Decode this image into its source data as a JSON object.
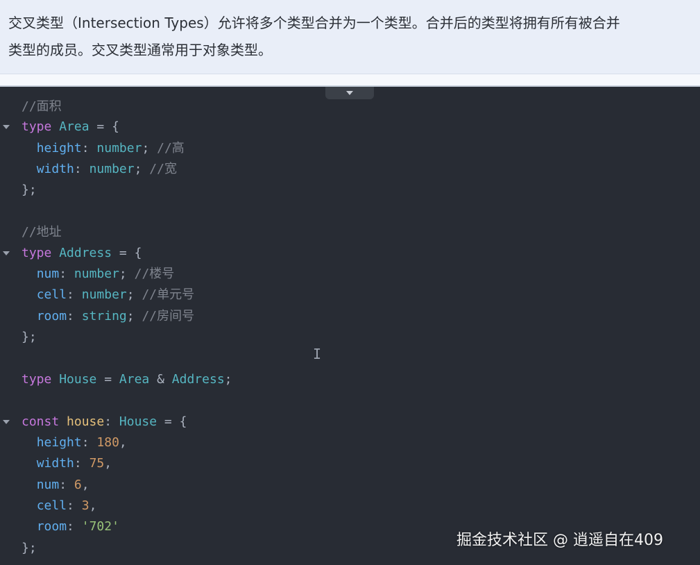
{
  "intro": {
    "line1": "交叉类型（Intersection Types）允许将多个类型合并为一个类型。合并后的类型将拥有所有被合并",
    "line2": "类型的成员。交叉类型通常用于对象类型。"
  },
  "code": {
    "comment_area": "//面积",
    "area_kw": "type",
    "area_name": "Area",
    "area_eq": " = {",
    "height_prop": "height",
    "height_type": "number",
    "height_comment": "//高",
    "width_prop": "width",
    "width_type": "number",
    "width_comment": "//宽",
    "close1": "};",
    "comment_address": "//地址",
    "addr_kw": "type",
    "addr_name": "Address",
    "addr_eq": " = {",
    "num_prop": "num",
    "num_type": "number",
    "num_comment": "//楼号",
    "cell_prop": "cell",
    "cell_type": "number",
    "cell_comment": "//单元号",
    "room_prop": "room",
    "room_type": "string",
    "room_comment": "//房间号",
    "close2": "};",
    "house_kw": "type",
    "house_name": "House",
    "house_area": "Area",
    "house_amp": "&",
    "house_addr": "Address",
    "const_kw": "const",
    "const_var": "house",
    "const_type": "House",
    "v_height_prop": "height",
    "v_height_val": "180",
    "v_width_prop": "width",
    "v_width_val": "75",
    "v_num_prop": "num",
    "v_num_val": "6",
    "v_cell_prop": "cell",
    "v_cell_val": "3",
    "v_room_prop": "room",
    "v_room_val": "'702'",
    "close3": "};"
  },
  "watermark": "掘金技术社区 @ 逍遥自在409",
  "colors": {
    "keyword": "#c678dd",
    "type": "#56b6c2",
    "property": "#61afef",
    "comment": "#7f848e",
    "number": "#d19a66",
    "string": "#98c379"
  }
}
